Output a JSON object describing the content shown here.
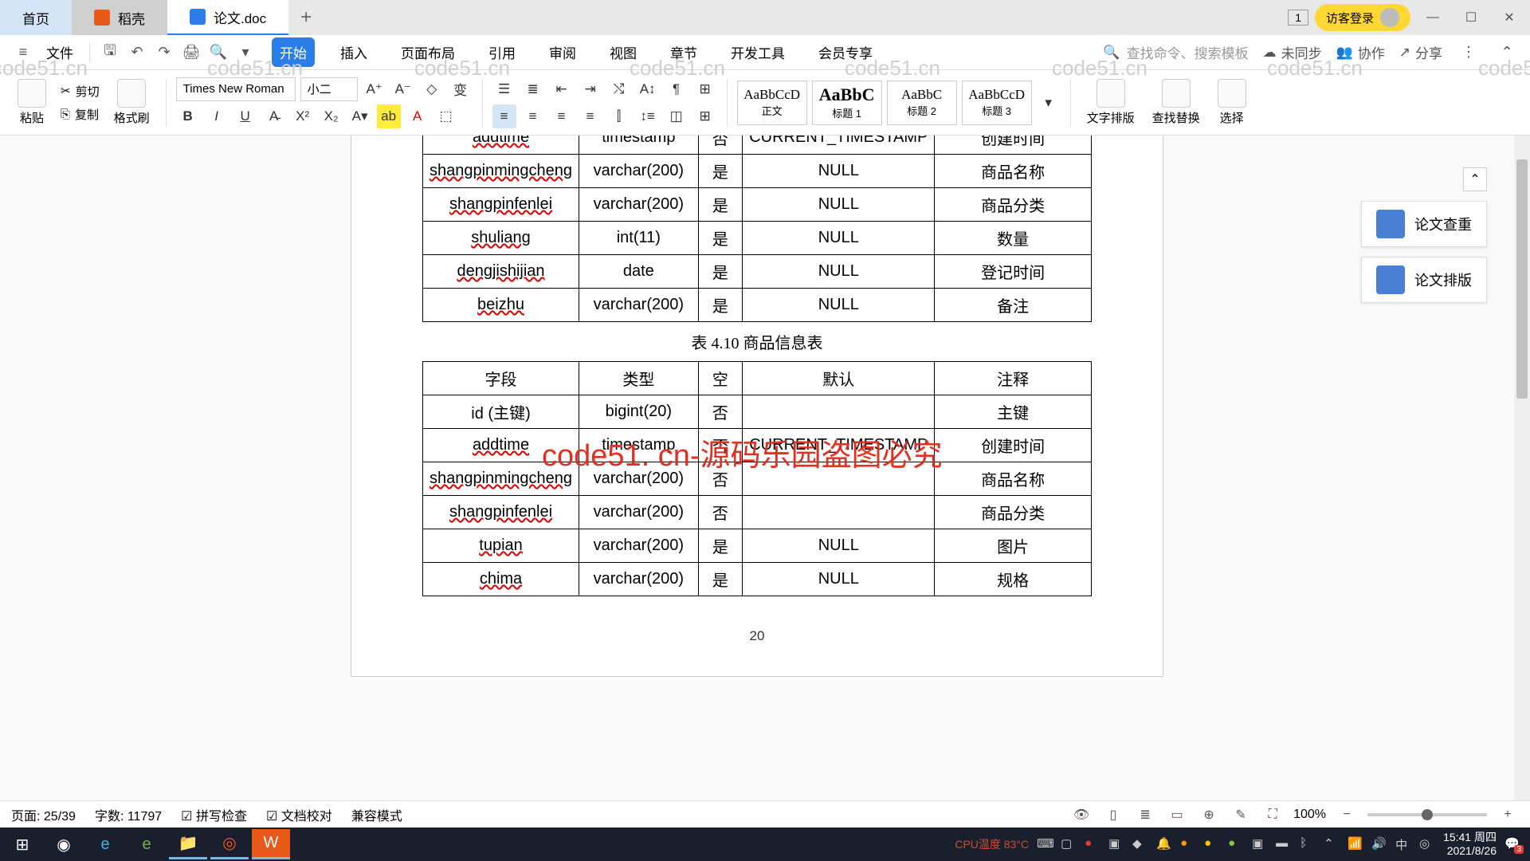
{
  "tabs": {
    "home": "首页",
    "doc1": "稻壳",
    "doc2": "论文.doc"
  },
  "titlebar": {
    "badge": "1",
    "login": "访客登录"
  },
  "menubar": {
    "file": "文件",
    "tabs": [
      "开始",
      "插入",
      "页面布局",
      "引用",
      "审阅",
      "视图",
      "章节",
      "开发工具",
      "会员专享"
    ],
    "search_ph": "查找命令、搜索模板",
    "unsync": "未同步",
    "collab": "协作",
    "share": "分享"
  },
  "ribbon": {
    "paste": "粘贴",
    "cut": "剪切",
    "copy": "复制",
    "formatbrush": "格式刷",
    "font_name": "Times New Roman",
    "font_size": "小二",
    "styles": {
      "body": "正文",
      "h1": "标题 1",
      "h2": "标题 2",
      "h3": "标题 3",
      "preview": "AaBbCcD"
    },
    "textlayout": "文字排版",
    "findreplace": "查找替换",
    "select": "选择"
  },
  "side": {
    "check": "论文查重",
    "layout": "论文排版"
  },
  "watermark_text": "code51.cn",
  "overlay_text": "code51. cn-源码乐园盗图必究",
  "table1": {
    "rows": [
      [
        "addtime",
        "timestamp",
        "否",
        "CURRENT_TIMESTAMP",
        "创建时间"
      ],
      [
        "shangpinmingcheng",
        "varchar(200)",
        "是",
        "NULL",
        "商品名称"
      ],
      [
        "shangpinfenlei",
        "varchar(200)",
        "是",
        "NULL",
        "商品分类"
      ],
      [
        "shuliang",
        "int(11)",
        "是",
        "NULL",
        "数量"
      ],
      [
        "dengjishijian",
        "date",
        "是",
        "NULL",
        "登记时间"
      ],
      [
        "beizhu",
        "varchar(200)",
        "是",
        "NULL",
        "备注"
      ]
    ]
  },
  "caption": "表 4.10  商品信息表",
  "table2": {
    "header": [
      "字段",
      "类型",
      "空",
      "默认",
      "注释"
    ],
    "rows": [
      [
        "id (主键)",
        "bigint(20)",
        "否",
        "",
        "主键"
      ],
      [
        "addtime",
        "timestamp",
        "否",
        "CURRENT_TIMESTAMP",
        "创建时间"
      ],
      [
        "shangpinmingcheng",
        "varchar(200)",
        "否",
        "",
        "商品名称"
      ],
      [
        "shangpinfenlei",
        "varchar(200)",
        "否",
        "",
        "商品分类"
      ],
      [
        "tupian",
        "varchar(200)",
        "是",
        "NULL",
        "图片"
      ],
      [
        "chima",
        "varchar(200)",
        "是",
        "NULL",
        "规格"
      ]
    ]
  },
  "page_number": "20",
  "status": {
    "page": "页面: 25/39",
    "words": "字数: 11797",
    "spell": "拼写检查",
    "proof": "文档校对",
    "compat": "兼容模式",
    "zoom": "100%"
  },
  "taskbar": {
    "cpu": "CPU温度",
    "temp": "83°C",
    "time": "15:41 周四",
    "date": "2021/8/26",
    "notify": "3"
  }
}
